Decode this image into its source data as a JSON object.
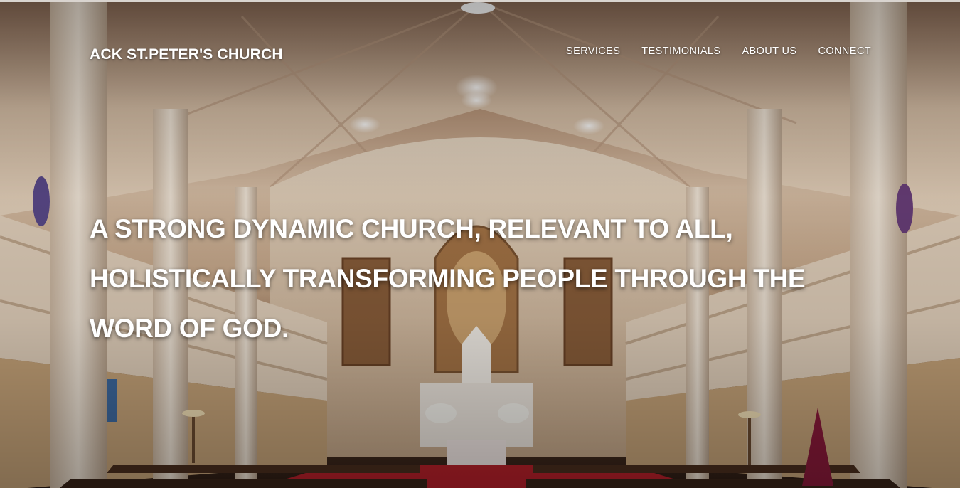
{
  "brand": {
    "name": "ACK ST.PETER'S CHURCH"
  },
  "nav": {
    "items": [
      {
        "label": "SERVICES"
      },
      {
        "label": "TESTIMONIALS"
      },
      {
        "label": "ABOUT US"
      },
      {
        "label": "CONNECT"
      }
    ]
  },
  "hero": {
    "headline": "A STRONG DYNAMIC CHURCH, RELEVANT TO ALL, HOLISTICALLY TRANSFORMING PEOPLE THROUGH THE WORD OF GOD."
  },
  "colors": {
    "text": "#ffffff",
    "ceiling": "#d8bfa6",
    "carpet": "#b8202a",
    "pews": "#3a2418"
  }
}
